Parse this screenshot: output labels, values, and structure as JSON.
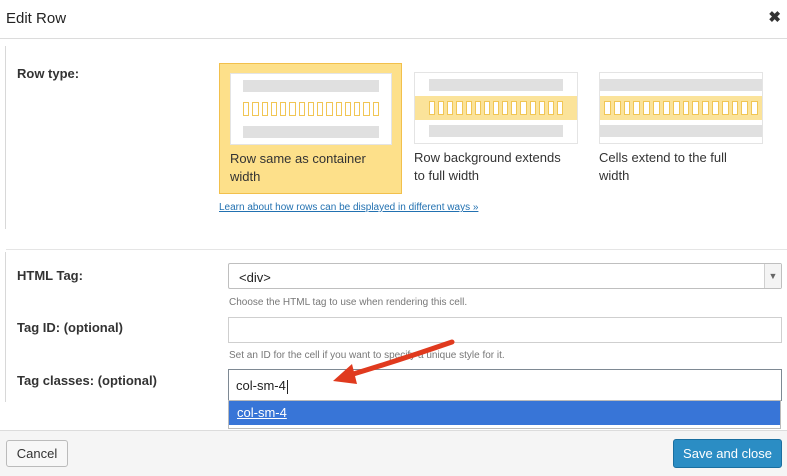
{
  "dialog": {
    "title": "Edit Row",
    "close_icon": "close-icon"
  },
  "row_type": {
    "label": "Row type:",
    "options": [
      {
        "label_line1": "Row same as container",
        "label_line2": "width",
        "selected": true
      },
      {
        "label_line1": "Row background extends",
        "label_line2": "to full width",
        "selected": false
      },
      {
        "label_line1": "Cells extend to the full",
        "label_line2": "width",
        "selected": false
      }
    ],
    "learn_link": "Learn about how rows can be displayed in different ways »"
  },
  "html_tag": {
    "label": "HTML Tag:",
    "value": "<div>",
    "help": "Choose the HTML tag to use when rendering this cell."
  },
  "tag_id": {
    "label": "Tag ID: (optional)",
    "value": "",
    "help": "Set an ID for the cell if you want to specify a unique style for it."
  },
  "tag_classes": {
    "label": "Tag classes: (optional)",
    "value": "col-sm-4",
    "suggestion": "col-sm-4"
  },
  "footer": {
    "cancel": "Cancel",
    "save": "Save and close"
  },
  "colors": {
    "accent": "#2b8dc4",
    "selected_bg": "#fde08a",
    "suggestion_bg": "#3875d7",
    "annotation_arrow": "#e03a1e"
  }
}
